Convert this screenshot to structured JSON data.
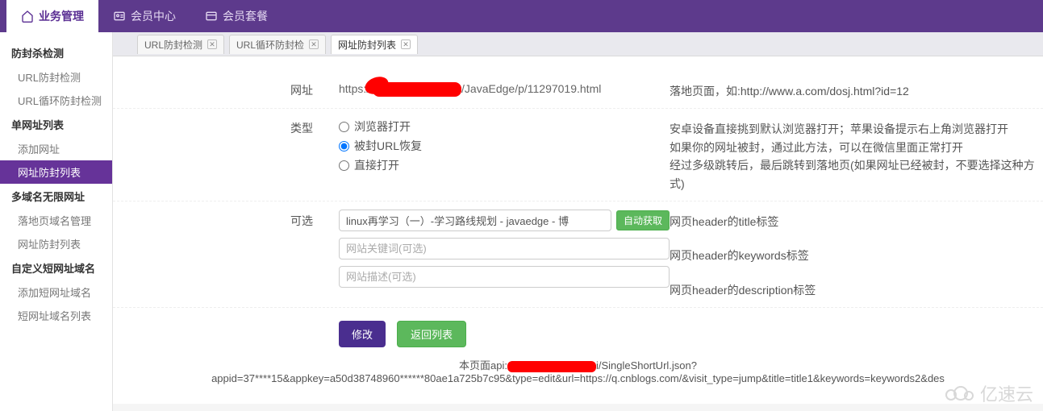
{
  "topnav": {
    "active": {
      "label": "业务管理",
      "icon": "home-icon"
    },
    "items": [
      {
        "label": "会员中心",
        "icon": "id-card-icon"
      },
      {
        "label": "会员套餐",
        "icon": "package-icon"
      }
    ]
  },
  "sidebar": {
    "groups": [
      {
        "title": "防封杀检测",
        "items": [
          {
            "label": "URL防封检测",
            "active": false
          },
          {
            "label": "URL循环防封检测",
            "active": false
          }
        ]
      },
      {
        "title": "单网址列表",
        "items": [
          {
            "label": "添加网址",
            "active": false
          },
          {
            "label": "网址防封列表",
            "active": true
          }
        ]
      },
      {
        "title": "多域名无限网址",
        "items": [
          {
            "label": "落地页域名管理",
            "active": false
          },
          {
            "label": "网址防封列表",
            "active": false
          }
        ]
      },
      {
        "title": "自定义短网址域名",
        "items": [
          {
            "label": "添加短网址域名",
            "active": false
          },
          {
            "label": "短网址域名列表",
            "active": false
          }
        ]
      }
    ]
  },
  "tabs": [
    {
      "label": "URL防封检测",
      "active": false
    },
    {
      "label": "URL循环防封检",
      "active": false
    },
    {
      "label": "网址防封列表",
      "active": true
    }
  ],
  "form": {
    "url": {
      "label": "网址",
      "prefix": "https://",
      "suffix": "/JavaEdge/p/11297019.html",
      "desc": "落地页面，如:http://www.a.com/dosj.html?id=12"
    },
    "type": {
      "label": "类型",
      "options": [
        {
          "label": "浏览器打开",
          "checked": false
        },
        {
          "label": "被封URL恢复",
          "checked": true
        },
        {
          "label": "直接打开",
          "checked": false
        }
      ],
      "descLines": [
        "安卓设备直接挑到默认浏览器打开；苹果设备提示右上角浏览器打开",
        "如果你的网址被封，通过此方法，可以在微信里面正常打开",
        "经过多级跳转后，最后跳转到落地页(如果网址已经被封，不要选择这种方式)"
      ]
    },
    "optional": {
      "label": "可选",
      "titleInput": "linux再学习（一）-学习路线规划 - javaedge - 博",
      "autoFetch": "自动获取",
      "keywordsPlaceholder": "网站关键词(可选)",
      "descPlaceholder": "网站描述(可选)",
      "titleDesc": "网页header的title标签",
      "keywordsDesc": "网页header的keywords标签",
      "descDesc": "网页header的description标签"
    },
    "actions": {
      "modify": "修改",
      "back": "返回列表"
    }
  },
  "api": {
    "prefix": "本页面api:",
    "suffix": "i/SingleShortUrl.json?",
    "query": "appid=37****15&appkey=a50d38748960******80ae1a725b7c95&type=edit&url=https://q.cnblogs.com/&visit_type=jump&title=title1&keywords=keywords2&des"
  },
  "watermark": "亿速云"
}
